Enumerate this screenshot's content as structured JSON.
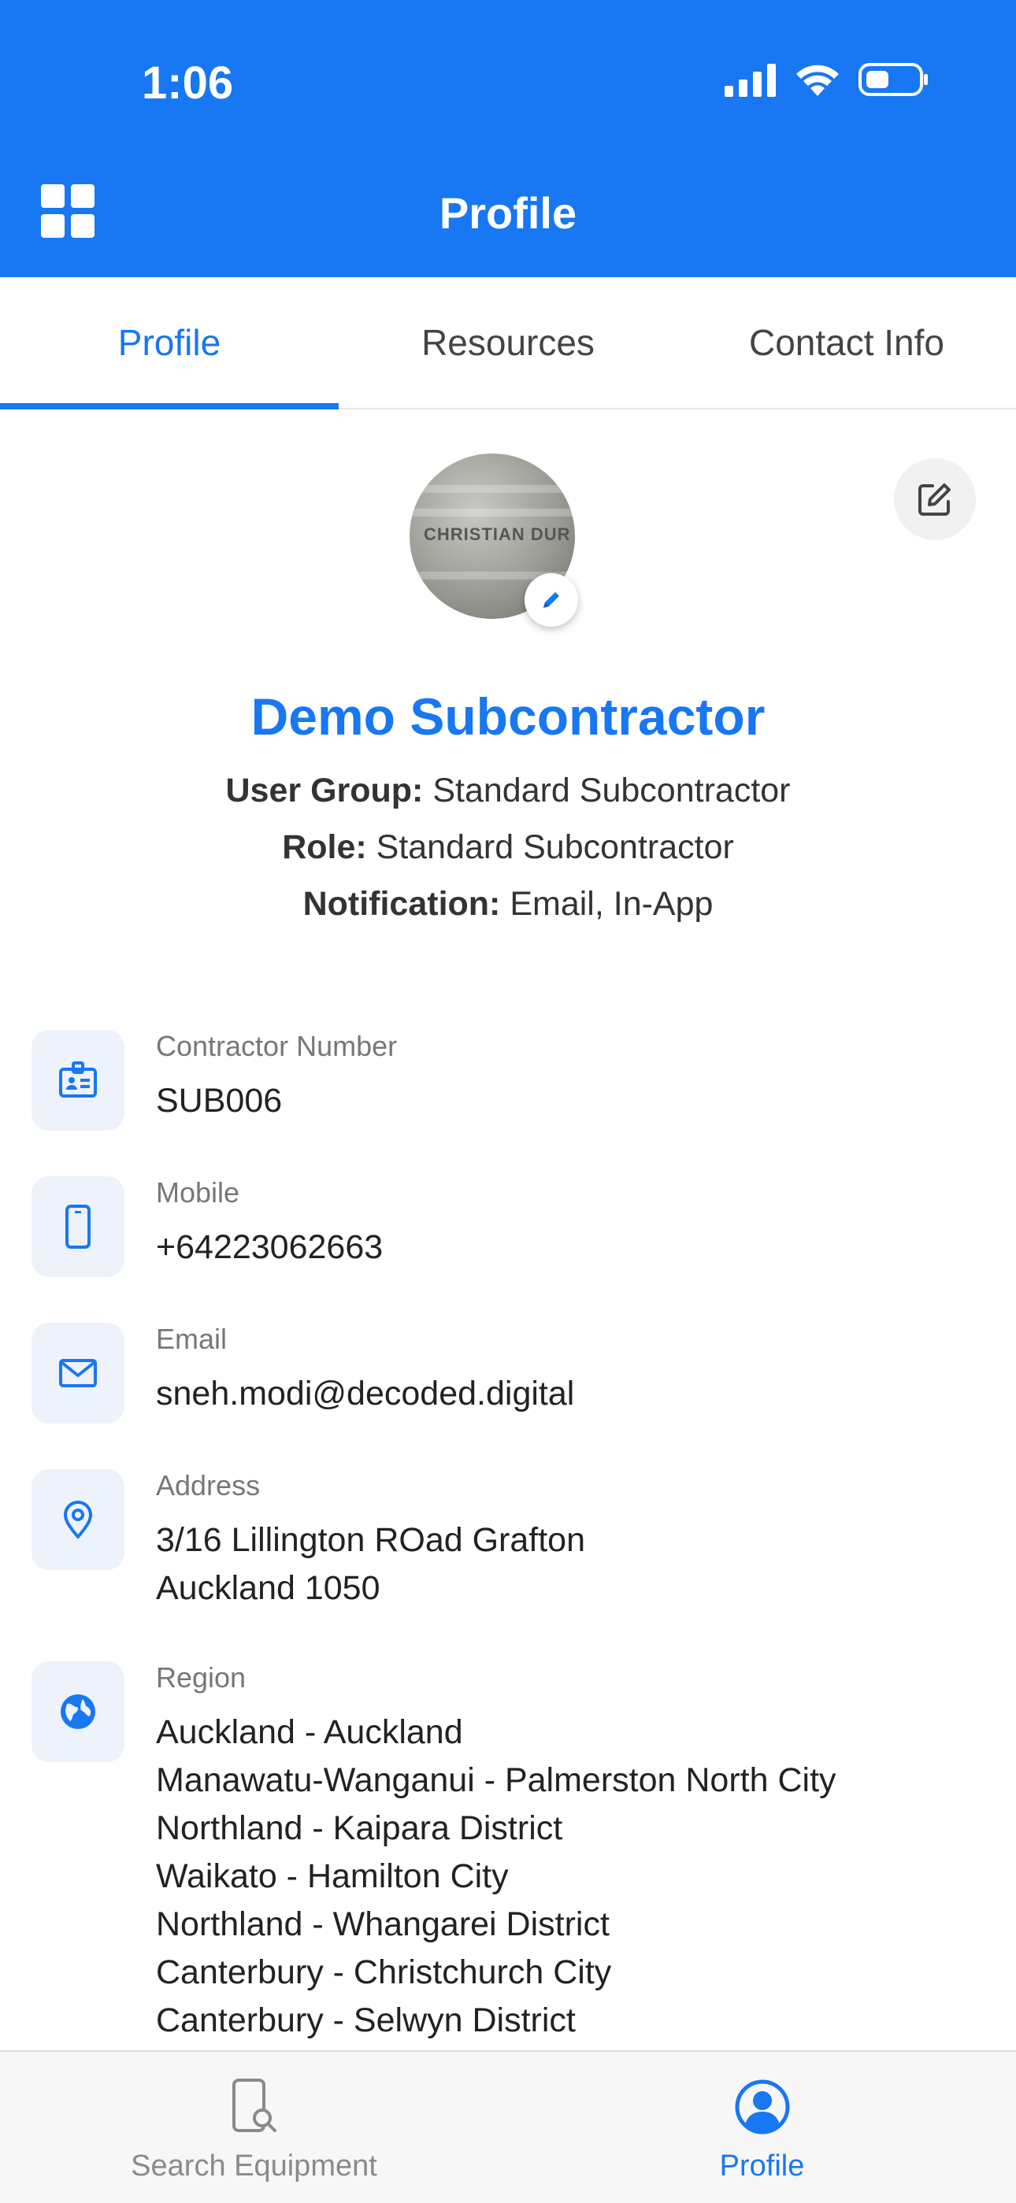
{
  "status_bar": {
    "time": "1:06"
  },
  "header": {
    "title": "Profile"
  },
  "tabs": [
    {
      "label": "Profile",
      "active": true
    },
    {
      "label": "Resources",
      "active": false
    },
    {
      "label": "Contact Info",
      "active": false
    }
  ],
  "avatar": {
    "photo_text": "CHRISTIAN DUR"
  },
  "profile": {
    "name": "Demo Subcontractor",
    "user_group_label": "User Group:",
    "user_group_value": "Standard Subcontractor",
    "role_label": "Role:",
    "role_value": "Standard Subcontractor",
    "notification_label": "Notification:",
    "notification_value": "Email, In-App"
  },
  "details": {
    "contractor_number": {
      "label": "Contractor Number",
      "value": "SUB006"
    },
    "mobile": {
      "label": "Mobile",
      "value": "+64223062663"
    },
    "email": {
      "label": "Email",
      "value": "sneh.modi@decoded.digital"
    },
    "address": {
      "label": "Address",
      "lines": [
        "3/16 Lillington ROad Grafton",
        "Auckland 1050"
      ]
    },
    "region": {
      "label": "Region",
      "lines": [
        "Auckland - Auckland",
        "Manawatu-Wanganui - Palmerston North City",
        "Northland - Kaipara District",
        "Waikato - Hamilton City",
        "Northland - Whangarei District",
        "Canterbury - Christchurch City",
        "Canterbury - Selwyn District"
      ]
    }
  },
  "bottom_nav": [
    {
      "label": "Search Equipment",
      "icon": "search-equipment-icon",
      "active": false
    },
    {
      "label": "Profile",
      "icon": "profile-icon",
      "active": true
    }
  ],
  "colors": {
    "accent": "#1877f2",
    "icon_bg": "#eef2fa"
  }
}
